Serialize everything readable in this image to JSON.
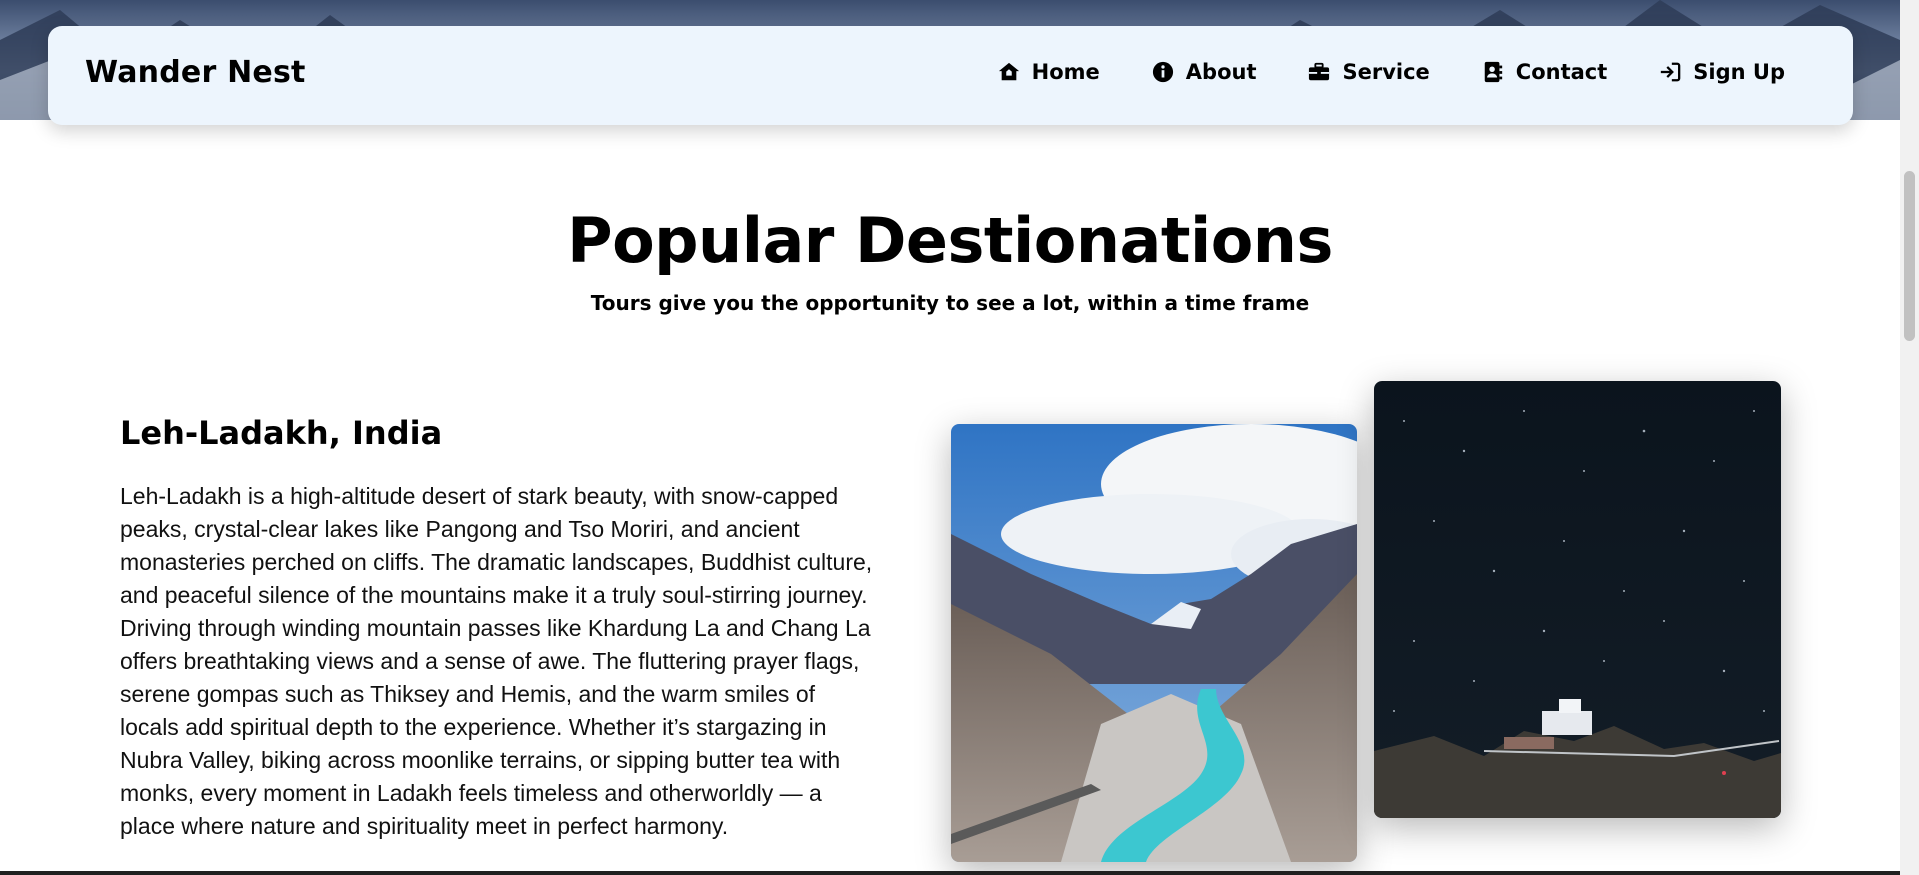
{
  "navbar": {
    "brand": "Wander Nest",
    "items": [
      {
        "label": "Home",
        "icon": "home-icon"
      },
      {
        "label": "About",
        "icon": "info-icon"
      },
      {
        "label": "Service",
        "icon": "briefcase-icon"
      },
      {
        "label": "Contact",
        "icon": "contact-book-icon"
      },
      {
        "label": "Sign Up",
        "icon": "sign-in-icon"
      }
    ]
  },
  "section": {
    "title": "Popular Destionations",
    "subtitle": "Tours give you the opportunity to see a lot, within a time frame"
  },
  "destination": {
    "name": "Leh-Ladakh, India",
    "description": "Leh-Ladakh is a high-altitude desert of stark beauty, with snow-capped peaks, crystal-clear lakes like Pangong and Tso Moriri, and ancient monasteries perched on cliffs. The dramatic landscapes, Buddhist culture, and peaceful silence of the mountains make it a truly soul-stirring journey. Driving through winding mountain passes like Khardung La and Chang La offers breathtaking views and a sense of awe. The fluttering prayer flags, serene gompas such as Thiksey and Hemis, and the warm smiles of locals add spiritual depth to the experience. Whether it’s stargazing in Nubra Valley, biking across moonlike terrains, or sipping butter tea with monks, every moment in Ladakh feels timeless and otherworldly — a place where nature and spirituality meet in perfect harmony."
  },
  "colors": {
    "navbar_bg": "#edf5fd",
    "text": "#000000",
    "river": "#3cc7d0",
    "night_sky": "#0b141d"
  }
}
